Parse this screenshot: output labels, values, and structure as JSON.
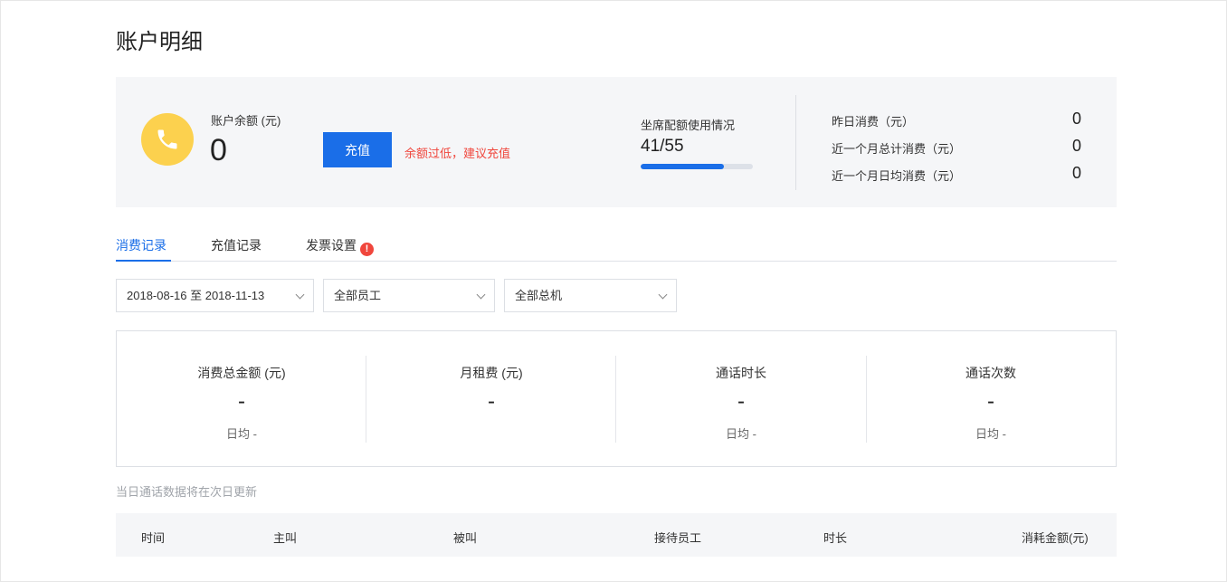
{
  "page": {
    "title": "账户明细"
  },
  "account": {
    "balance_label": "账户余额 (元)",
    "balance_value": "0",
    "recharge_label": "充值",
    "low_balance_warning": "余额过低，建议充值"
  },
  "quota": {
    "label": "坐席配额使用情况",
    "value": "41/55",
    "used": 41,
    "total": 55
  },
  "stats": [
    {
      "label": "昨日消费（元）",
      "value": "0"
    },
    {
      "label": "近一个月总计消费（元）",
      "value": "0"
    },
    {
      "label": "近一个月日均消费（元）",
      "value": "0"
    }
  ],
  "tabs": [
    {
      "label": "消费记录",
      "active": true
    },
    {
      "label": "充值记录",
      "active": false
    },
    {
      "label": "发票设置",
      "active": false,
      "alert": "!"
    }
  ],
  "filters": {
    "date_range": "2018-08-16 至 2018-11-13",
    "employee": "全部员工",
    "line": "全部总机"
  },
  "metrics": [
    {
      "label": "消费总金额 (元)",
      "value": "-",
      "daily": "日均 -"
    },
    {
      "label": "月租费 (元)",
      "value": "-",
      "daily": ""
    },
    {
      "label": "通话时长",
      "value": "-",
      "daily": "日均 -"
    },
    {
      "label": "通话次数",
      "value": "-",
      "daily": "日均 -"
    }
  ],
  "note": "当日通话数据将在次日更新",
  "table": {
    "columns": [
      "时间",
      "主叫",
      "被叫",
      "接待员工",
      "时长",
      "消耗金额(元)"
    ]
  },
  "colors": {
    "accent": "#1a6ee8",
    "warning": "#f0463c",
    "phone_icon_bg": "#fcd14e"
  }
}
